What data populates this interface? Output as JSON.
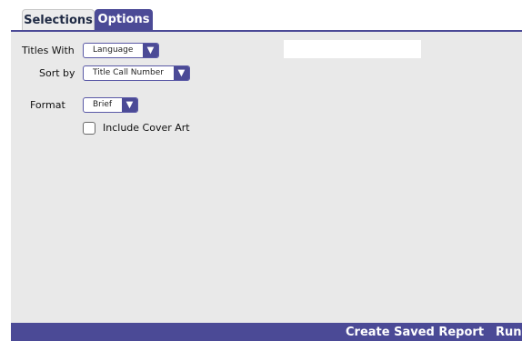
{
  "tabs": [
    {
      "label": "Selections",
      "active": false
    },
    {
      "label": "Options",
      "active": true
    }
  ],
  "form": {
    "titles_with": {
      "label": "Titles With",
      "value": "Language"
    },
    "sort_by": {
      "label": "Sort by",
      "value": "Title Call Number"
    },
    "format": {
      "label": "Format",
      "value": "Brief"
    },
    "include_cover_art": {
      "label": "Include Cover Art",
      "checked": false
    },
    "filter_text": ""
  },
  "footer": {
    "create_saved_report": "Create Saved Report",
    "run": "Run"
  },
  "colors": {
    "accent": "#4b4a96",
    "panel": "#e9e9e9"
  },
  "icons": {
    "dropdown": "chevron-down-icon"
  }
}
